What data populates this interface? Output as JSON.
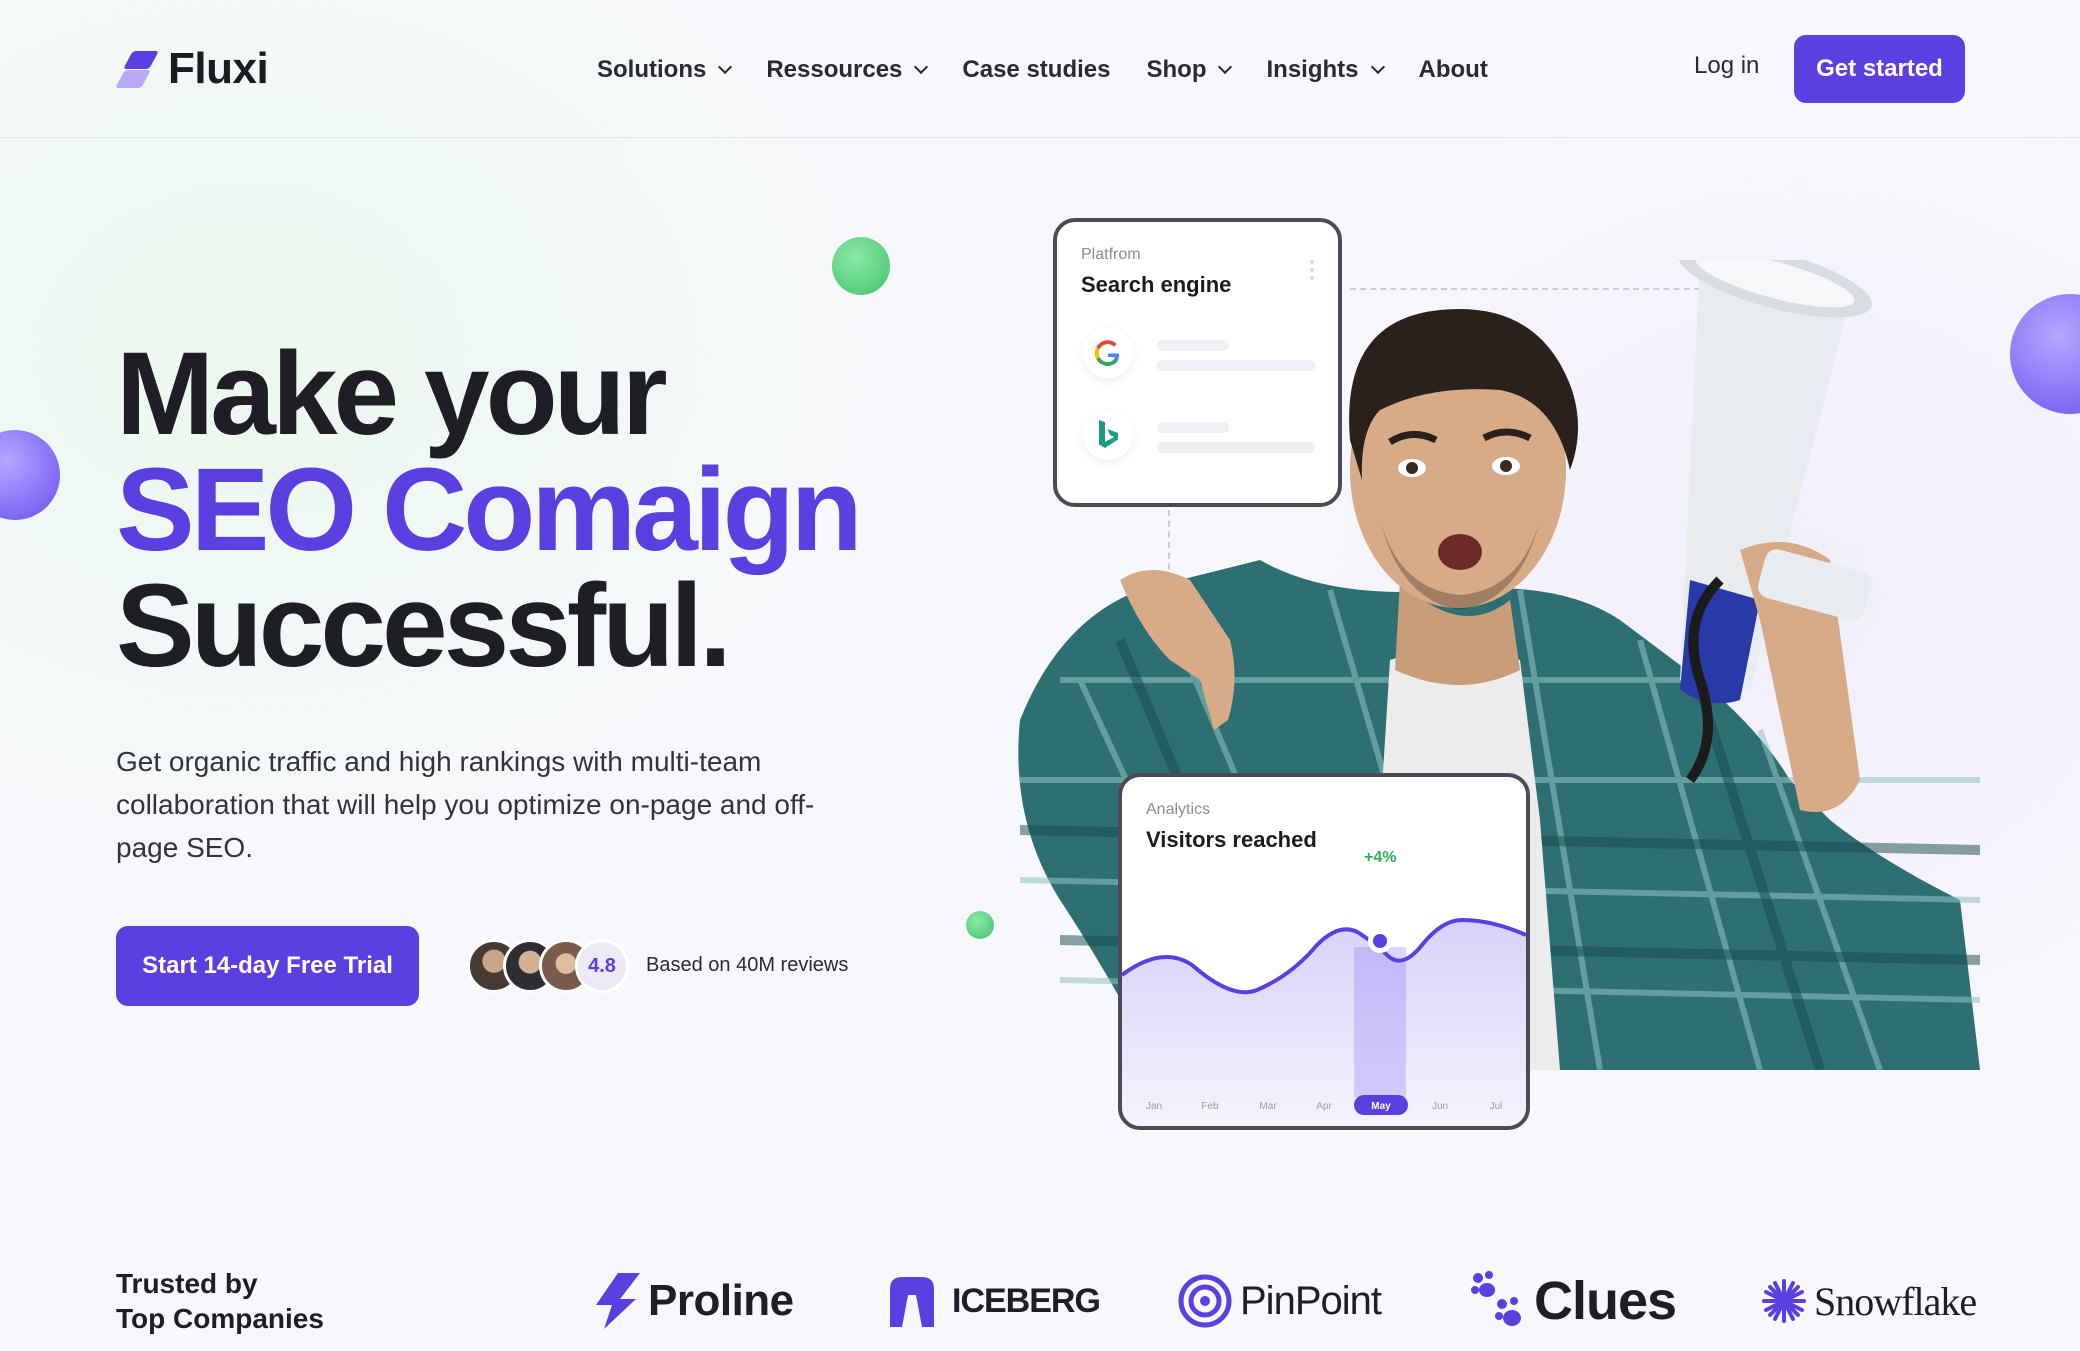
{
  "brand": {
    "name": "Fluxi"
  },
  "nav": {
    "items": [
      {
        "label": "Solutions",
        "dropdown": true
      },
      {
        "label": "Ressources",
        "dropdown": true
      },
      {
        "label": "Case studies",
        "dropdown": false
      },
      {
        "label": "Shop",
        "dropdown": true
      },
      {
        "label": "Insights",
        "dropdown": true
      },
      {
        "label": "About",
        "dropdown": false
      }
    ],
    "login_label": "Log in",
    "cta_label": "Get started"
  },
  "hero": {
    "headline_line1": "Make your",
    "headline_line2": "SEO Comaign",
    "headline_line3": "Successful.",
    "subtext": "Get organic traffic and high rankings with multi-team collaboration that will help you optimize on-page and off-page SEO.",
    "cta_label": "Start 14-day Free Trial",
    "rating": "4.8",
    "reviews_text": "Based on 40M reviews"
  },
  "search_card": {
    "label": "Platfrom",
    "title": "Search engine",
    "engines": [
      "google-icon",
      "bing-icon"
    ]
  },
  "analytics_card": {
    "label": "Analytics",
    "title": "Visitors reached",
    "change": "+4%",
    "months": [
      "Jan",
      "Feb",
      "Mar",
      "Apr",
      "May",
      "Jun",
      "Jul"
    ],
    "selected_month": "May"
  },
  "trusted": {
    "line1": "Trusted by",
    "line2": "Top Companies",
    "logos": [
      "Proline",
      "ICEBERG",
      "PinPoint",
      "Clues",
      "Snowflake"
    ]
  },
  "colors": {
    "accent": "#5b3fe0",
    "green": "#3ec46a",
    "text": "#1e1e24"
  }
}
